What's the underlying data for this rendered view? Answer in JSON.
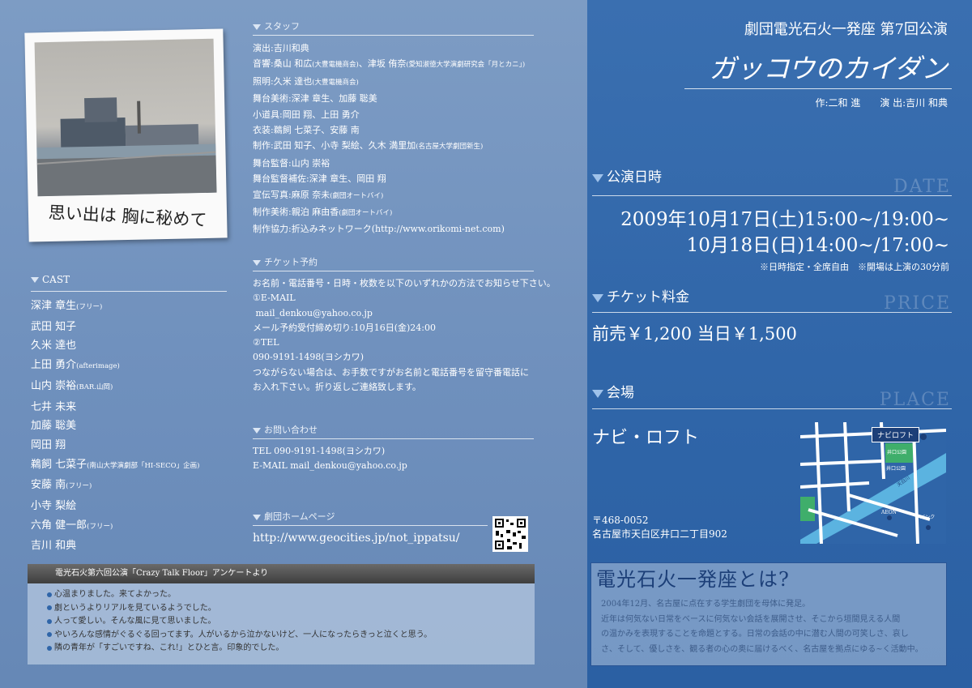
{
  "left": {
    "polaroid_caption": "思い出は 胸に秘めて",
    "staff": {
      "title": "スタッフ",
      "lines": [
        {
          "main": "演出:吉川和典",
          "small": ""
        },
        {
          "main": "音響:桑山 和広",
          "small": "(大豊電機商会)",
          "main2": "、津坂 侑奈",
          "small2": "(愛知淑徳大学演劇研究会「月とカニ」)"
        },
        {
          "main": "照明:久米 達也",
          "small": "(大豊電機商会)",
          "main2": "",
          "small2": ""
        },
        {
          "main": "舞台美術:深津 章生、加藤 聡美",
          "small": "",
          "main2": "",
          "small2": ""
        },
        {
          "main": "小道具:岡田 翔、上田 勇介",
          "small": "",
          "main2": "",
          "small2": ""
        },
        {
          "main": "衣装:鵜飼 七菜子、安藤 南",
          "small": "",
          "main2": "",
          "small2": ""
        },
        {
          "main": "制作:武田 知子、小寺 梨絵、久木 満里加",
          "small": "(名古屋大学劇団新生)",
          "main2": "",
          "small2": ""
        },
        {
          "main": "舞台監督:山内 崇裕",
          "small": "",
          "main2": "",
          "small2": ""
        },
        {
          "main": "舞台監督補佐:深津 章生、岡田 翔",
          "small": "",
          "main2": "",
          "small2": ""
        },
        {
          "main": "宣伝写真:麻原 奈未",
          "small": "(劇団オートバイ)",
          "main2": "",
          "small2": ""
        },
        {
          "main": "制作美術:親泊 麻由香",
          "small": "(劇団オートバイ)",
          "main2": "",
          "small2": ""
        },
        {
          "main": "制作協力:折込みネットワーク(http://www.orikomi-net.com)",
          "small": "",
          "main2": "",
          "small2": ""
        }
      ]
    },
    "ticket": {
      "title": "チケット予約",
      "lines": [
        "お名前・電話番号・日時・枚数を以下のいずれかの方法でお知らせ下さい。",
        "①E-MAIL",
        " mail_denkou@yahoo.co.jp",
        "メール予約受付締め切り:10月16日(金)24:00",
        "②TEL",
        "090-9191-1498(ヨシカワ)",
        "つながらない場合は、お手数ですがお名前と電話番号を留守番電話に",
        "お入れ下さい。折り返しご連絡致します。"
      ]
    },
    "contact": {
      "title": "お問い合わせ",
      "tel": "TEL 090-9191-1498(ヨシカワ)",
      "email": "E-MAIL mail_denkou@yahoo.co.jp"
    },
    "homepage": {
      "title": "劇団ホームページ",
      "url": "http://www.geocities.jp/not_ippatsu/"
    },
    "cast": {
      "title": "CAST",
      "members": [
        {
          "name": "深津 章生",
          "note": "(フリー)"
        },
        {
          "name": "武田 知子",
          "note": ""
        },
        {
          "name": "久米 達也",
          "note": ""
        },
        {
          "name": "上田 勇介",
          "note": "(afterimage)"
        },
        {
          "name": "山内 崇裕",
          "note": "(BAR.山岡)"
        },
        {
          "name": "七井 未来",
          "note": ""
        },
        {
          "name": "加藤 聡美",
          "note": ""
        },
        {
          "name": "岡田 翔",
          "note": ""
        },
        {
          "name": "鵜飼 七菜子",
          "note": "(南山大学演劇部「HI-SECO」企画)"
        },
        {
          "name": "安藤 南",
          "note": "(フリー)"
        },
        {
          "name": "小寺 梨絵",
          "note": ""
        },
        {
          "name": "六角 健一郎",
          "note": "(フリー)"
        },
        {
          "name": "吉川 和典",
          "note": ""
        }
      ]
    },
    "survey": {
      "title": "電光石火第六回公演「Crazy Talk Floor」アンケートより",
      "items": [
        "心温まりました。来てよかった。",
        "劇というよりリアルを見ているようでした。",
        "人って愛しい。そんな風に見て思いました。",
        "やいろんな感情がぐるぐる回ってます。人がいるから泣かないけど、一人になったらきっと泣くと思う。",
        "隣の青年が「すごいですね、これ!」とひと言。印象的でした。"
      ]
    }
  },
  "right": {
    "subtitle": "劇団電光石火一発座 第7回公演",
    "title": "ガッコウのカイダン",
    "credits": "作:二和 進　　演 出:吉川 和典",
    "date_section": {
      "title": "公演日時",
      "watermark": "DATE",
      "line1": "2009年10月17日(土)15:00~/19:00~",
      "line2": "10月18日(日)14:00~/17:00~",
      "note": "※日時指定・全席自由　※開場は上演の30分前"
    },
    "price_section": {
      "title": "チケット料金",
      "watermark": "PRICE",
      "text": "前売￥1,200 当日￥1,500"
    },
    "place_section": {
      "title": "会場",
      "watermark": "PLACE",
      "venue": "ナビ・ロフト",
      "postal": "〒468-0052",
      "address": "名古屋市天白区井口二丁目902",
      "map_labels": {
        "venue": "ナビロフト",
        "park1": "井口公園",
        "park2": "井口公園",
        "river": "天白川",
        "store": "AEON",
        "bank": "バンク"
      }
    },
    "about": {
      "title": "電光石火一発座とは?",
      "lines": [
        "2004年12月、名古屋に点在する学生劇団を母体に発足。",
        "近年は何気ない日常をベースに何気ない会話を展開させ、そこから垣間見える人間",
        "の温かみを表現することを命題とする。日常の会話の中に潜む人間の可笑しさ、哀し",
        "さ、そして、優しさを、観る者の心の奥に届けるべく、名古屋を拠点にゆる~く活動中。"
      ]
    }
  },
  "colors": {
    "left_bg": "#7d9cc4",
    "right_bg": "#3a6fb0",
    "accent_dark": "#1c3f78"
  }
}
